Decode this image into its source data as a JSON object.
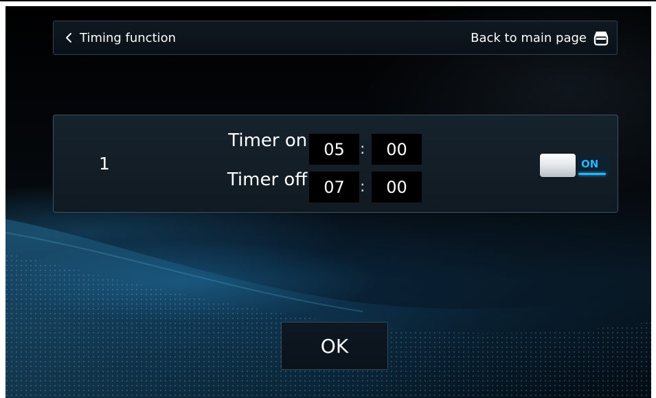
{
  "header": {
    "back_label": "Timing function",
    "main_page_label": "Back to main page"
  },
  "timer": {
    "index": "1",
    "on_label": "Timer on:",
    "off_label": "Timer off:",
    "on_hour": "05",
    "on_minute": "00",
    "off_hour": "07",
    "off_minute": "00",
    "separator": ":",
    "toggle_label": "ON",
    "enabled": true
  },
  "ok_label": "OK",
  "icons": {
    "back": "chevron-left-icon",
    "main_page": "home-icon"
  },
  "colors": {
    "accent": "#27b5ff",
    "panel_border": "#3a5466",
    "background": "#000000"
  }
}
